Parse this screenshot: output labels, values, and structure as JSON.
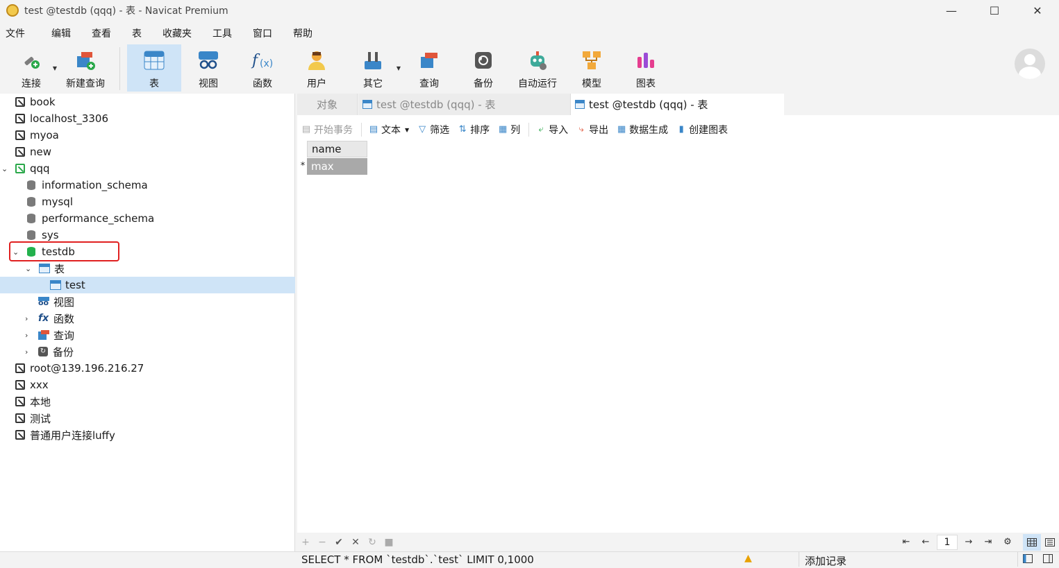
{
  "window": {
    "title": "test @testdb (qqq) - 表 - Navicat Premium",
    "minimize": "—",
    "maximize": "☐",
    "close": "✕"
  },
  "menu": [
    "文件",
    "编辑",
    "查看",
    "表",
    "收藏夹",
    "工具",
    "窗口",
    "帮助"
  ],
  "toolbar": {
    "connect": "连接",
    "new_query": "新建查询",
    "table": "表",
    "view": "视图",
    "function": "函数",
    "user": "用户",
    "others": "其它",
    "query": "查询",
    "backup": "备份",
    "automation": "自动运行",
    "model": "模型",
    "chart": "图表"
  },
  "tree": {
    "book": "book",
    "localhost": "localhost_3306",
    "myoa": "myoa",
    "new": "new",
    "qqq": "qqq",
    "information_schema": "information_schema",
    "mysql": "mysql",
    "performance_schema": "performance_schema",
    "sys": "sys",
    "testdb": "testdb",
    "tables": "表",
    "test": "test",
    "views": "视图",
    "functions": "函数",
    "queries": "查询",
    "backups": "备份",
    "root": "root@139.196.216.27",
    "xxx": "xxx",
    "local": "本地",
    "ceshi": "测试",
    "luffy": "普通用户连接luffy"
  },
  "tabs": {
    "objects": "对象",
    "tab1": "test @testdb (qqq) - 表",
    "tab2": "test @testdb (qqq) - 表"
  },
  "content_toolbar": {
    "begin_transaction": "开始事务",
    "text": "文本",
    "filter": "筛选",
    "sort": "排序",
    "columns": "列",
    "import": "导入",
    "export": "导出",
    "generate_data": "数据生成",
    "create_chart": "创建图表"
  },
  "grid": {
    "column": "name",
    "row_marker": "*",
    "cell": "max"
  },
  "bottom": {
    "add": "+",
    "remove": "−",
    "apply": "✔",
    "discard": "✕",
    "refresh": "↻",
    "stop": "■",
    "first": "⇤",
    "prev": "←",
    "page": "1",
    "next": "→",
    "last": "⇥",
    "settings": "⚙"
  },
  "status": {
    "sql": "SELECT * FROM `testdb`.`test` LIMIT 0,1000",
    "mode": "添加记录"
  },
  "colors": {
    "accent": "#3a86c8",
    "selected": "#cfe4f7",
    "highlight_box": "#e02020",
    "db_active": "#23b14d"
  }
}
